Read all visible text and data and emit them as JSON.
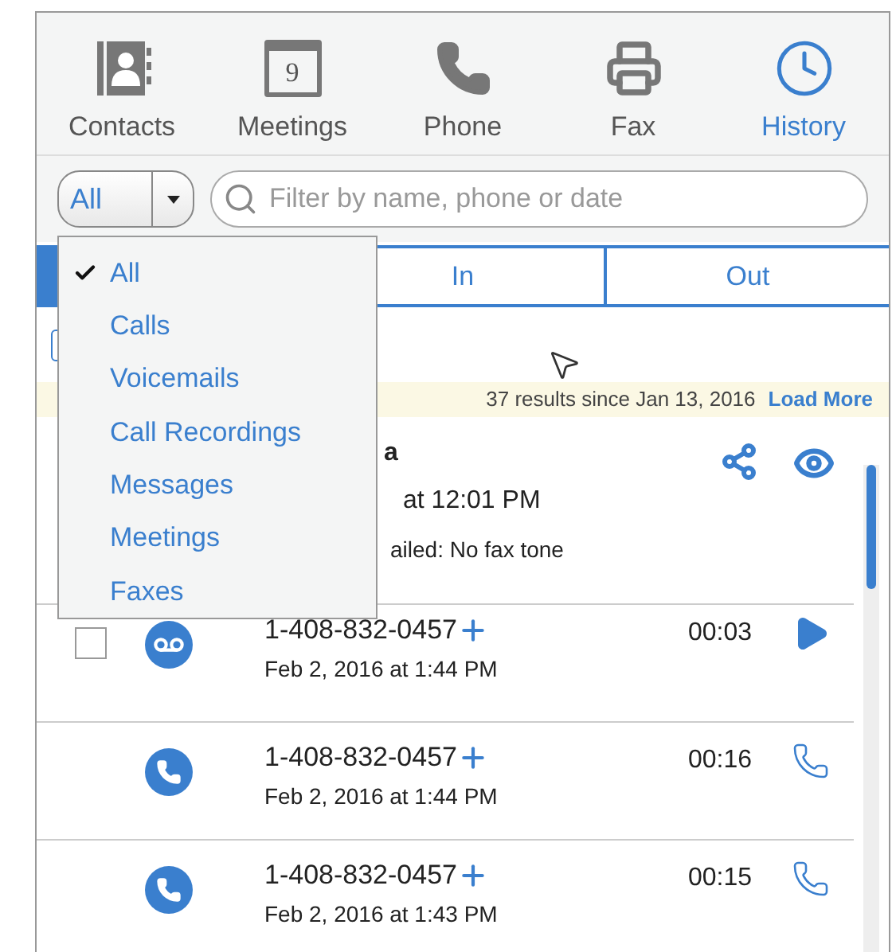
{
  "toolbar": [
    {
      "kind": "contacts",
      "label": "Contacts",
      "selected": false
    },
    {
      "kind": "meetings",
      "label": "Meetings",
      "badge": "9",
      "selected": false
    },
    {
      "kind": "phone",
      "label": "Phone",
      "selected": false
    },
    {
      "kind": "fax",
      "label": "Fax",
      "selected": false
    },
    {
      "kind": "history",
      "label": "History",
      "selected": true
    }
  ],
  "filter": {
    "type_select": {
      "value": "All"
    },
    "search": {
      "placeholder": "Filter by name, phone or date"
    }
  },
  "tabs": [
    {
      "selected": true
    },
    {
      "label": "In",
      "selected": false
    },
    {
      "label": "Out",
      "selected": false
    }
  ],
  "select_all": {
    "checked": false
  },
  "results_bar": {
    "text": "37 results since Jan 13, 2016",
    "link": "Load More"
  },
  "records": [
    {
      "kind": "fax",
      "name": "a",
      "time": "at 12:01 PM",
      "status": "ailed: No fax tone"
    },
    {
      "kind": "voicemail",
      "checked": false,
      "number": "1-408-832-0457",
      "time": "Feb 2, 2016 at 1:44 PM",
      "duration": "00:03"
    },
    {
      "kind": "call",
      "number": "1-408-832-0457",
      "time": "Feb 2, 2016 at 1:44 PM",
      "duration": "00:16"
    },
    {
      "kind": "call",
      "number": "1-408-832-0457",
      "time": "Feb 2, 2016 at 1:43 PM",
      "duration": "00:15"
    }
  ],
  "dropdown": {
    "items": [
      {
        "label": "All",
        "selected": true
      },
      {
        "label": "Calls",
        "selected": false
      },
      {
        "label": "Voicemails",
        "selected": false
      },
      {
        "label": "Call Recordings",
        "selected": false
      },
      {
        "label": "Messages",
        "selected": false
      },
      {
        "label": "Meetings",
        "selected": false
      },
      {
        "label": "Faxes",
        "selected": false
      }
    ]
  }
}
